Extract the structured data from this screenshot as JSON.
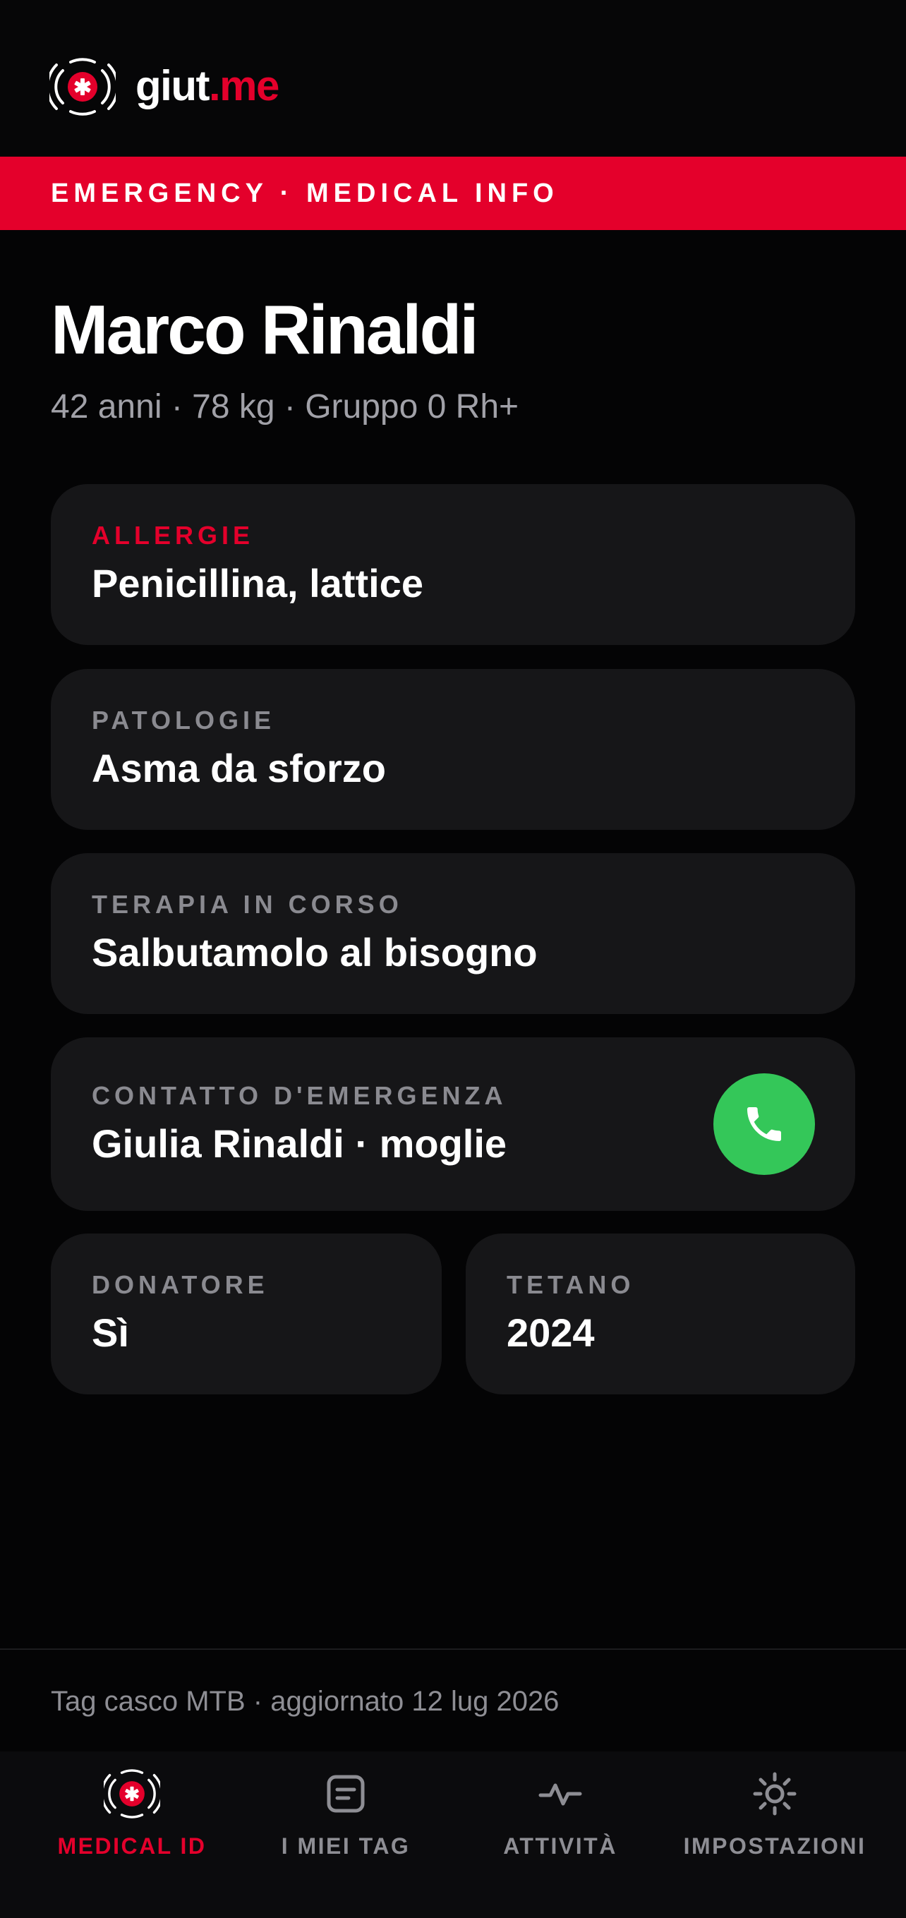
{
  "header": {
    "brand_main": "giut",
    "brand_suffix": ".me"
  },
  "banner": {
    "text": "EMERGENCY · MEDICAL INFO"
  },
  "profile": {
    "name": "Marco Rinaldi",
    "details": "42 anni · 78 kg · Gruppo 0 Rh+"
  },
  "cards": {
    "allergie": {
      "label": "ALLERGIE",
      "value": "Penicillina, lattice"
    },
    "patologie": {
      "label": "PATOLOGIE",
      "value": "Asma da sforzo"
    },
    "terapia": {
      "label": "TERAPIA IN CORSO",
      "value": "Salbutamolo al bisogno"
    },
    "contatto": {
      "label": "CONTATTO D'EMERGENZA",
      "value": "Giulia Rinaldi · moglie",
      "action_icon": "phone-icon"
    },
    "donatore": {
      "label": "DONATORE",
      "value": "Sì"
    },
    "tetano": {
      "label": "TETANO",
      "value": "2024"
    }
  },
  "footer": {
    "note": "Tag casco MTB · aggiornato 12 lug 2026"
  },
  "nav": {
    "items": [
      {
        "label": "MEDICAL ID",
        "icon": "medical-id-icon",
        "active": true
      },
      {
        "label": "I MIEI TAG",
        "icon": "tag-icon",
        "active": false
      },
      {
        "label": "ATTIVITÀ",
        "icon": "activity-icon",
        "active": false
      },
      {
        "label": "IMPOSTAZIONI",
        "icon": "settings-icon",
        "active": false
      }
    ]
  },
  "colors": {
    "accent": "#e4002b",
    "call": "#34c759",
    "card": "#161618",
    "background": "#040405"
  }
}
